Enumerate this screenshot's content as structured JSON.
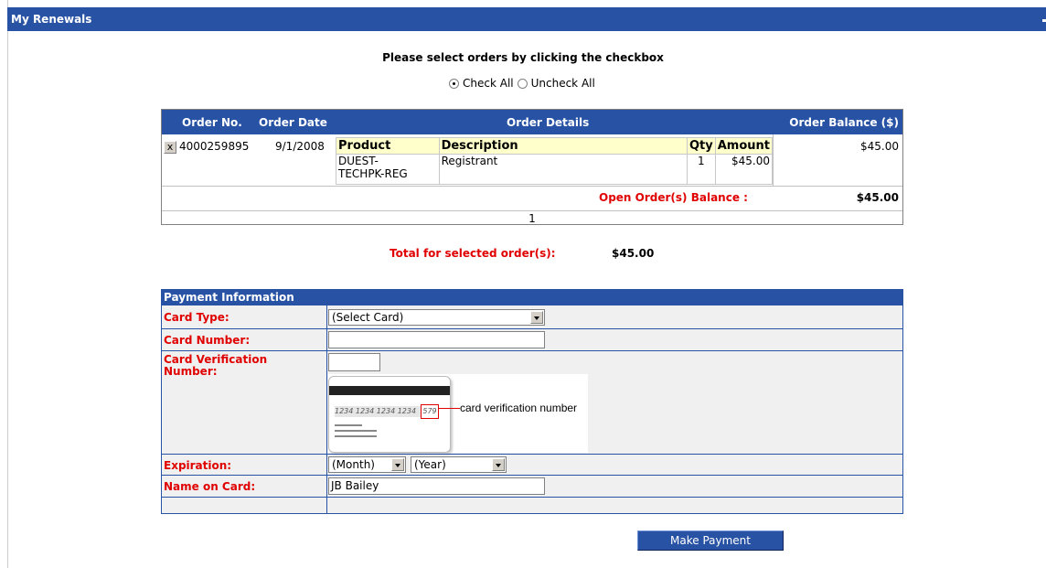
{
  "header": {
    "title": "My Renewals"
  },
  "instructions": "Please select orders by clicking the checkbox",
  "check_options": {
    "check_all": "Check All",
    "uncheck_all": "Uncheck All"
  },
  "orders": {
    "columns": {
      "order_no": "Order No.",
      "order_date": "Order Date",
      "order_details": "Order Details",
      "order_balance": "Order Balance ($)"
    },
    "row": {
      "remove_glyph": "x",
      "order_no": "4000259895",
      "order_date": "9/1/2008",
      "details_headers": {
        "product": "Product",
        "description": "Description",
        "qty": "Qty",
        "amount": "Amount"
      },
      "product_line1": "DUEST-",
      "product_line2": "TECHPK-REG",
      "description": "Registrant",
      "qty": "1",
      "amount": "$45.00",
      "balance": "$45.00"
    },
    "open_balance_label": "Open Order(s) Balance :",
    "open_balance_value": "$45.00",
    "page_number": "1"
  },
  "total": {
    "label": "Total for selected order(s):",
    "value": "$45.00"
  },
  "payment": {
    "section_title": "Payment Information",
    "card_type_label": "Card Type:",
    "card_type_value": "(Select Card)",
    "card_number_label": "Card Number:",
    "card_number_value": "",
    "cvv_label_line1": "Card Verification",
    "cvv_label_line2": "Number:",
    "cvv_value": "",
    "cvv_illustration": {
      "numbers": "1234 1234 1234 1234",
      "code": "579",
      "caption": "card verification number"
    },
    "expiration_label": "Expiration:",
    "month_value": "(Month)",
    "year_value": "(Year)",
    "name_label": "Name on Card:",
    "name_value": "JB Bailey"
  },
  "actions": {
    "make_payment": "Make Payment"
  },
  "colors": {
    "header_blue": "#2852a4",
    "required_red": "#e00000",
    "product_header_bg": "#ffffcc"
  }
}
